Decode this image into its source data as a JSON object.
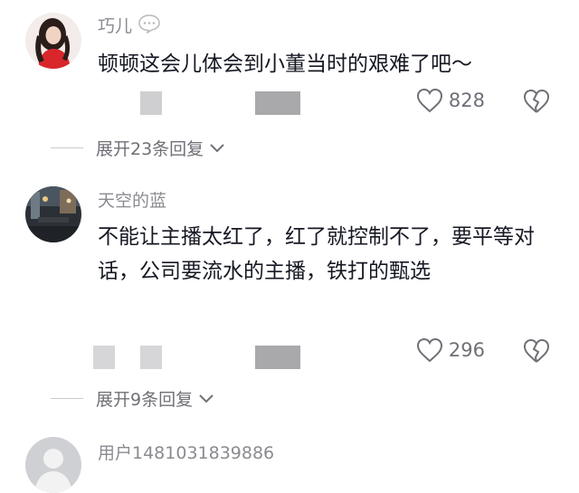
{
  "comments": [
    {
      "username": "巧儿",
      "text": "顿顿这会儿体会到小董当时的艰难了吧～",
      "likes": "828",
      "expand_label": "展开23条回复",
      "avatar_icon": "avatar-woman-red-sweater"
    },
    {
      "username": "天空的蓝",
      "text": "不能让主播太红了，红了就控制不了，要平等对话，公司要流水的主播，铁打的甄选",
      "likes": "296",
      "expand_label": "展开9条回复",
      "avatar_icon": "avatar-night-street"
    },
    {
      "username": "用户1481031839886",
      "avatar_icon": "avatar-default-user"
    }
  ],
  "colors": {
    "username": "#8a8b91",
    "text": "#161823",
    "meta": "#6f7077",
    "placeholder": "#cfcfd2"
  }
}
